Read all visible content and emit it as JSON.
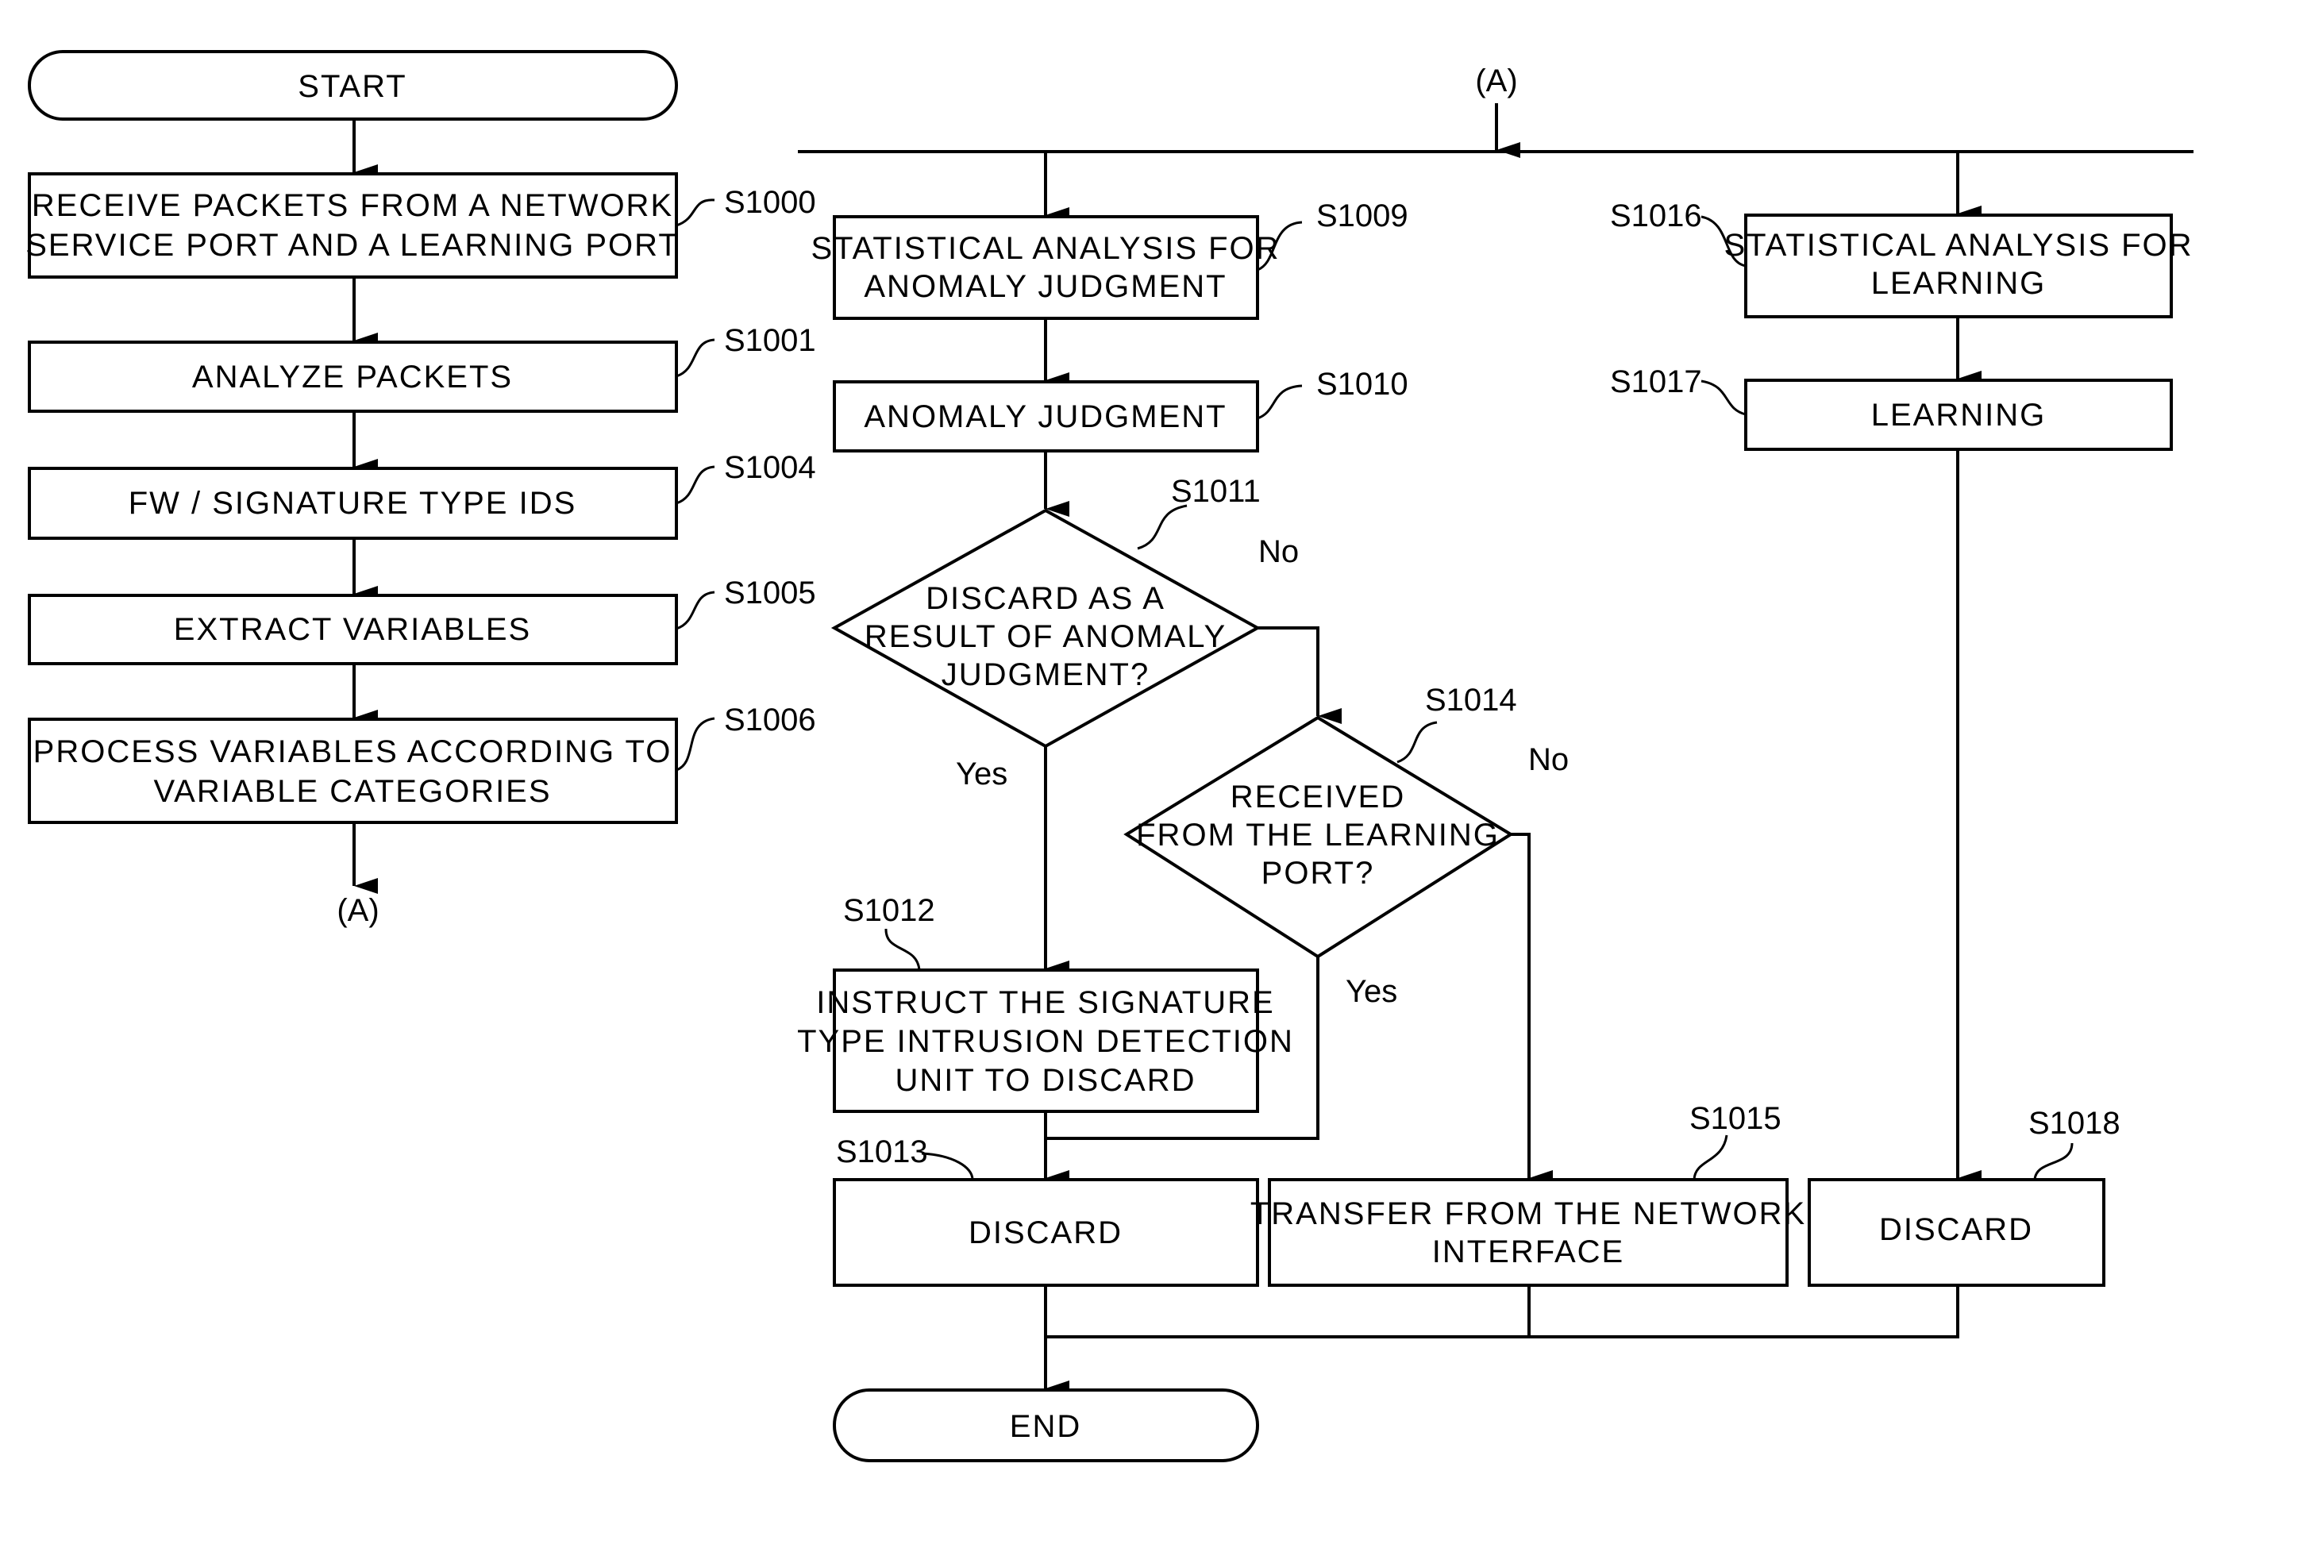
{
  "nodes": {
    "start": {
      "text": [
        "START"
      ]
    },
    "s1000": {
      "step": "S1000",
      "text": [
        "RECEIVE PACKETS FROM A NETWORK",
        "SERVICE PORT AND A LEARNING PORT"
      ]
    },
    "s1001": {
      "step": "S1001",
      "text": [
        "ANALYZE PACKETS"
      ]
    },
    "s1004": {
      "step": "S1004",
      "text": [
        "FW / SIGNATURE TYPE IDS"
      ]
    },
    "s1005": {
      "step": "S1005",
      "text": [
        "EXTRACT VARIABLES"
      ]
    },
    "s1006": {
      "step": "S1006",
      "text": [
        "PROCESS VARIABLES ACCORDING TO",
        "VARIABLE CATEGORIES"
      ]
    },
    "connector_out": {
      "text": [
        "(A)"
      ]
    },
    "connector_in": {
      "text": [
        "(A)"
      ]
    },
    "s1009": {
      "step": "S1009",
      "text": [
        "STATISTICAL ANALYSIS FOR",
        "ANOMALY JUDGMENT"
      ]
    },
    "s1010": {
      "step": "S1010",
      "text": [
        "ANOMALY JUDGMENT"
      ]
    },
    "s1011": {
      "step": "S1011",
      "text": [
        "DISCARD AS A",
        "RESULT OF ANOMALY",
        "JUDGMENT?"
      ]
    },
    "s1012": {
      "step": "S1012",
      "text": [
        "INSTRUCT THE SIGNATURE",
        "TYPE INTRUSION DETECTION",
        "UNIT TO DISCARD"
      ]
    },
    "s1013": {
      "step": "S1013",
      "text": [
        "DISCARD"
      ]
    },
    "s1014": {
      "step": "S1014",
      "text": [
        "RECEIVED",
        "FROM THE LEARNING",
        "PORT?"
      ]
    },
    "s1015": {
      "step": "S1015",
      "text": [
        "TRANSFER FROM THE NETWORK",
        "INTERFACE"
      ]
    },
    "s1016": {
      "step": "S1016",
      "text": [
        "STATISTICAL ANALYSIS FOR",
        "LEARNING"
      ]
    },
    "s1017": {
      "step": "S1017",
      "text": [
        "LEARNING"
      ]
    },
    "s1018": {
      "step": "S1018",
      "text": [
        "DISCARD"
      ]
    },
    "end": {
      "text": [
        "END"
      ]
    }
  },
  "branch_labels": {
    "s1011_yes": "Yes",
    "s1011_no": "No",
    "s1014_yes": "Yes",
    "s1014_no": "No"
  }
}
